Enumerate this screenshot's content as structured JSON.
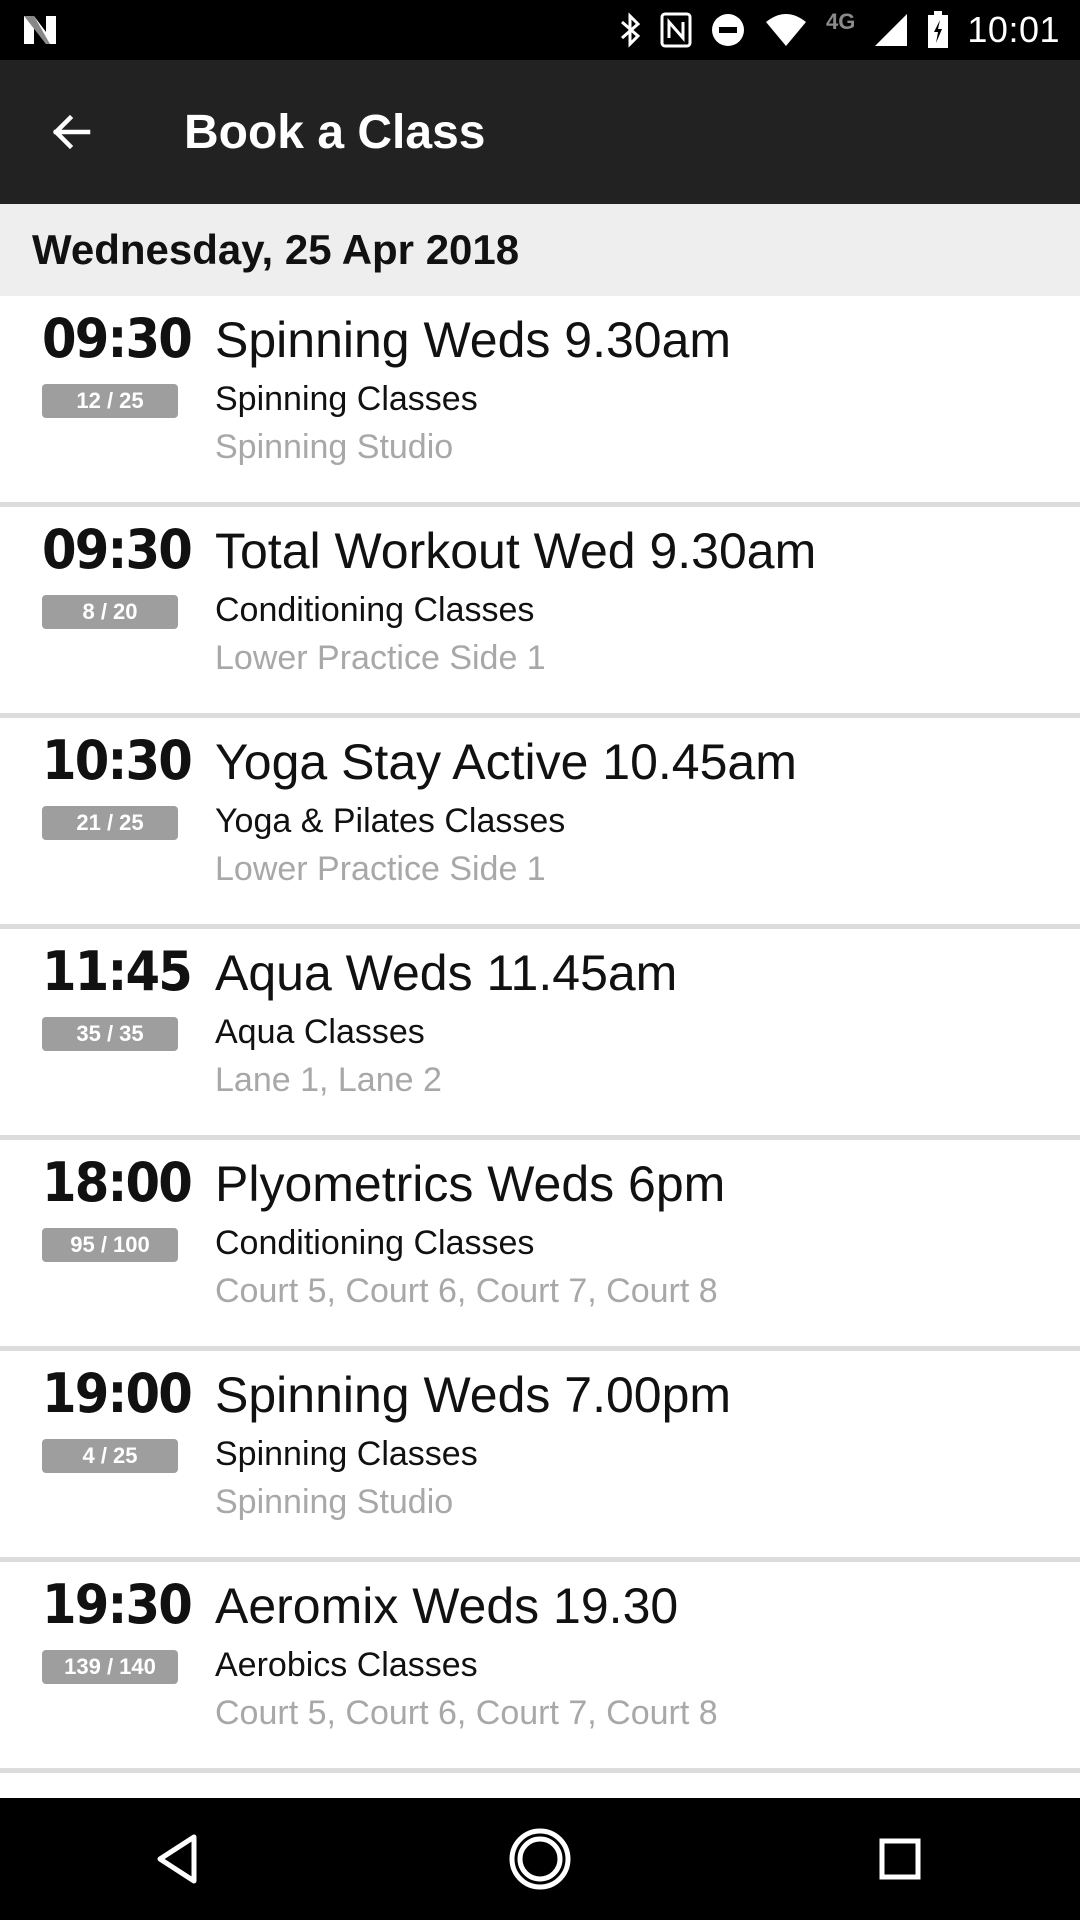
{
  "status_bar": {
    "time": "10:01",
    "network_label": "4G",
    "icons": [
      "n-logo-icon",
      "bluetooth-icon",
      "nfc-icon",
      "do-not-disturb-icon",
      "wifi-icon",
      "signal-icon",
      "battery-icon"
    ]
  },
  "app_bar": {
    "title": "Book a Class",
    "back_icon": "arrow-left-icon"
  },
  "date_header": "Wednesday, 25 Apr 2018",
  "classes": [
    {
      "time": "09:30",
      "capacity": "12 / 25",
      "name": "Spinning Weds 9.30am",
      "category": "Spinning Classes",
      "location": "Spinning Studio"
    },
    {
      "time": "09:30",
      "capacity": "8 / 20",
      "name": "Total Workout Wed 9.30am",
      "category": "Conditioning Classes",
      "location": "Lower Practice Side 1"
    },
    {
      "time": "10:30",
      "capacity": "21 / 25",
      "name": "Yoga Stay Active 10.45am",
      "category": "Yoga & Pilates Classes",
      "location": "Lower Practice Side 1"
    },
    {
      "time": "11:45",
      "capacity": "35 / 35",
      "name": "Aqua Weds 11.45am",
      "category": "Aqua Classes",
      "location": "Lane 1, Lane 2"
    },
    {
      "time": "18:00",
      "capacity": "95 / 100",
      "name": "Plyometrics Weds 6pm",
      "category": "Conditioning Classes",
      "location": "Court 5, Court 6, Court 7, Court 8"
    },
    {
      "time": "19:00",
      "capacity": "4 / 25",
      "name": "Spinning Weds 7.00pm",
      "category": "Spinning Classes",
      "location": "Spinning Studio"
    },
    {
      "time": "19:30",
      "capacity": "139 / 140",
      "name": "Aeromix Weds 19.30",
      "category": "Aerobics Classes",
      "location": "Court 5, Court 6, Court 7, Court 8"
    }
  ],
  "nav_bar": {
    "icons": [
      "back-triangle-icon",
      "home-circle-icon",
      "recents-square-icon"
    ]
  },
  "colors": {
    "app_bar": "#222222",
    "status_bar": "#000000",
    "date_header_bg": "#eeeeee",
    "badge": "#9e9e9e",
    "location_text": "#a8a8a8",
    "divider": "#dcdcdc"
  }
}
